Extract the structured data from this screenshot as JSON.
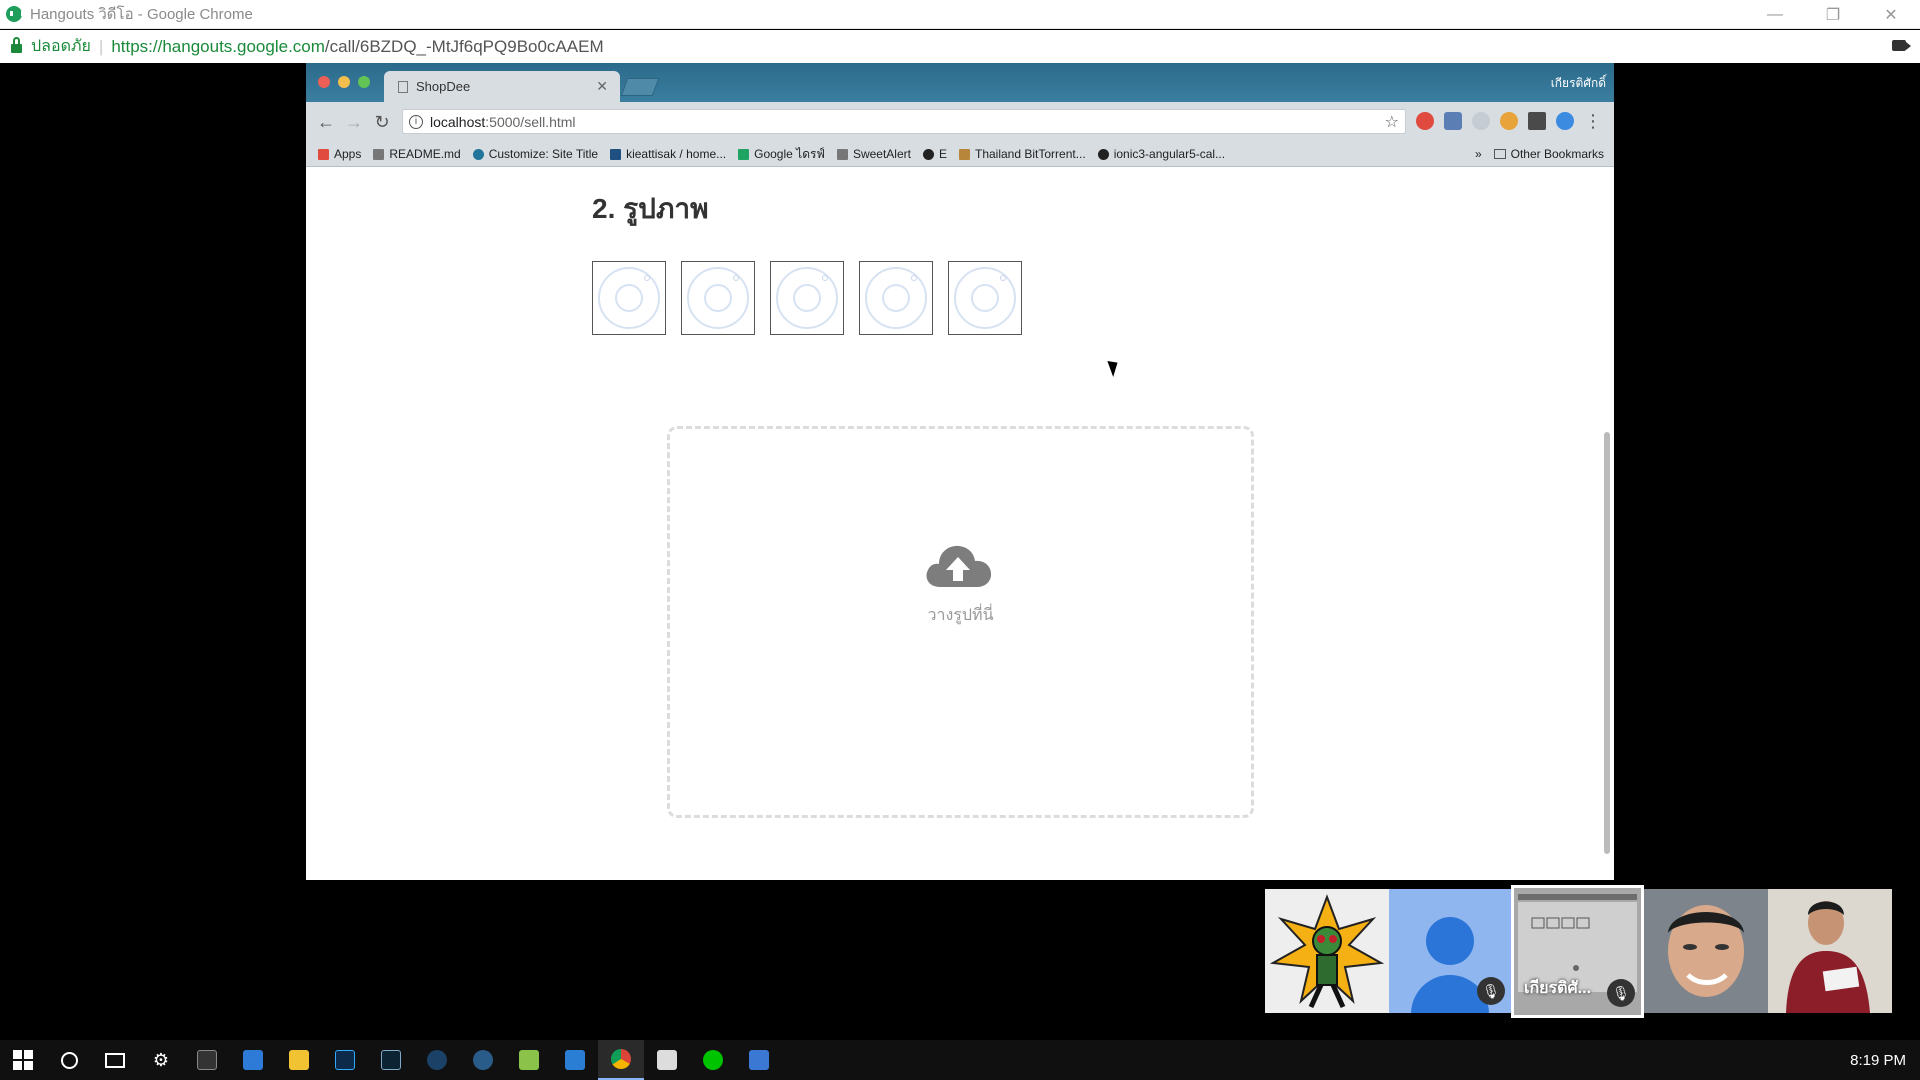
{
  "outer_window": {
    "title": "Hangouts วิดีโอ - Google Chrome",
    "secure_label": "ปลอดภัย",
    "url_prefix": "https://",
    "url_host": "hangouts.google.com",
    "url_rest": "/call/6BZDQ_-MtJf6qPQ9Bo0cAAEM"
  },
  "inner_browser": {
    "tab_title": "ShopDee",
    "user_label": "เกียรติศักดิ์",
    "url_host": "localhost",
    "url_path": ":5000/sell.html",
    "bookmarks": [
      {
        "label": "Apps",
        "icon": "apps-grid-icon",
        "color": "#e04a3f"
      },
      {
        "label": "README.md",
        "icon": "document-icon",
        "color": "#777777"
      },
      {
        "label": "Customize: Site Title",
        "icon": "wordpress-icon",
        "color": "#21759b"
      },
      {
        "label": "kieattisak / home...",
        "icon": "bitbucket-icon",
        "color": "#205081"
      },
      {
        "label": "Google ไดรฟ์",
        "icon": "google-drive-icon",
        "color": "#1fa463"
      },
      {
        "label": "SweetAlert",
        "icon": "document-icon",
        "color": "#777777"
      },
      {
        "label": "E",
        "icon": "github-icon",
        "color": "#222222"
      },
      {
        "label": "Thailand BitTorrent...",
        "icon": "torrent-icon",
        "color": "#b8863b"
      },
      {
        "label": "ionic3-angular5-cal...",
        "icon": "github-icon",
        "color": "#222222"
      }
    ],
    "more_bookmarks": "»",
    "other_bookmarks": "Other Bookmarks"
  },
  "page": {
    "heading": "2. รูปภาพ",
    "thumbnail_count": 5,
    "dropzone_label": "วางรูปที่นี่"
  },
  "participants": [
    {
      "name": "",
      "muted": false,
      "kind": "image"
    },
    {
      "name": "",
      "muted": true,
      "kind": "default-avatar"
    },
    {
      "name": "เกียรติศั...",
      "muted": true,
      "kind": "screen-share"
    },
    {
      "name": "",
      "muted": false,
      "kind": "camera"
    },
    {
      "name": "",
      "muted": false,
      "kind": "camera"
    }
  ],
  "taskbar": {
    "clock": "8:19 PM"
  },
  "colors": {
    "secure_green": "#1a8a3a",
    "inner_tabbar": "#2c6a8a",
    "avatar_blue": "#2b74d8"
  }
}
